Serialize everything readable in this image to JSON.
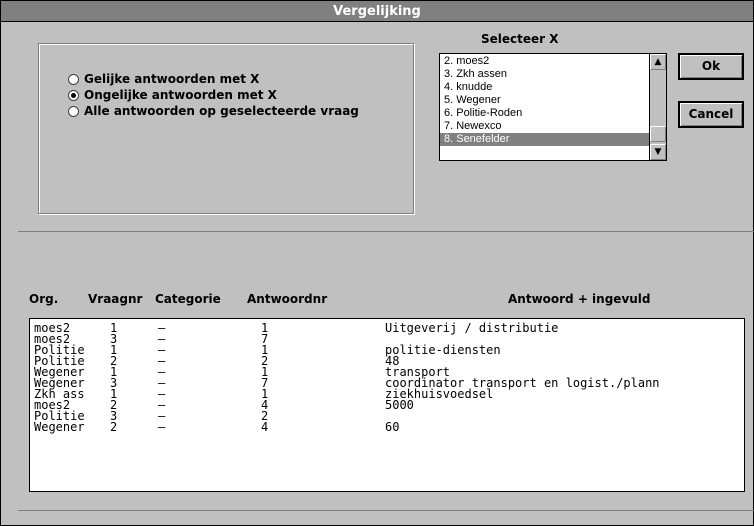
{
  "window": {
    "title": "Vergelijking"
  },
  "mode_options": [
    {
      "label": "Gelijke antwoorden met X",
      "checked": false
    },
    {
      "label": "Ongelijke antwoorden met X",
      "checked": true
    },
    {
      "label": "Alle antwoorden op geselecteerde vraag",
      "checked": false
    }
  ],
  "select_x": {
    "label": "Selecteer X",
    "items": [
      "2. moes2",
      "3. Zkh assen",
      "4. knudde",
      "5. Wegener",
      "6. Politie-Roden",
      "7. Newexco",
      "8. Senefelder"
    ],
    "selected": "8. Senefelder"
  },
  "buttons": {
    "ok": "Ok",
    "cancel": "Cancel"
  },
  "results": {
    "headers": {
      "org": "Org.",
      "vraagnr": "Vraagnr",
      "categorie": "Categorie",
      "antwoordnr": "Antwoordnr",
      "antwoord": "Antwoord + ingevuld"
    },
    "rows": [
      {
        "org": "moes2",
        "vraagnr": "1",
        "categorie": "–",
        "antwoordnr": "1",
        "antwoord": "Uitgeverij / distributie"
      },
      {
        "org": "moes2",
        "vraagnr": "3",
        "categorie": "–",
        "antwoordnr": "7",
        "antwoord": ""
      },
      {
        "org": "Politie",
        "vraagnr": "1",
        "categorie": "–",
        "antwoordnr": "1",
        "antwoord": "politie-diensten"
      },
      {
        "org": "Politie",
        "vraagnr": "2",
        "categorie": "–",
        "antwoordnr": "2",
        "antwoord": "48"
      },
      {
        "org": "Wegener",
        "vraagnr": "1",
        "categorie": "–",
        "antwoordnr": "1",
        "antwoord": "transport"
      },
      {
        "org": "Wegener",
        "vraagnr": "3",
        "categorie": "–",
        "antwoordnr": "7",
        "antwoord": "coordinator transport en logist./plann"
      },
      {
        "org": "Zkh ass",
        "vraagnr": "1",
        "categorie": "–",
        "antwoordnr": "1",
        "antwoord": "ziekhuisvoedsel"
      },
      {
        "org": "moes2",
        "vraagnr": "2",
        "categorie": "–",
        "antwoordnr": "4",
        "antwoord": "5000"
      },
      {
        "org": "Politie",
        "vraagnr": "3",
        "categorie": "–",
        "antwoordnr": "2",
        "antwoord": ""
      },
      {
        "org": "Wegener",
        "vraagnr": "2",
        "categorie": "–",
        "antwoordnr": "4",
        "antwoord": "60"
      }
    ]
  },
  "icons": {
    "radio_on": "radio-selected-icon",
    "radio_off": "radio-unselected-icon",
    "scroll_up": "arrow-up-icon",
    "scroll_down": "arrow-down-icon"
  },
  "colors": {
    "window_bg": "#c0c0c0",
    "titlebar_bg": "#808080",
    "selection_bg": "#808080"
  }
}
